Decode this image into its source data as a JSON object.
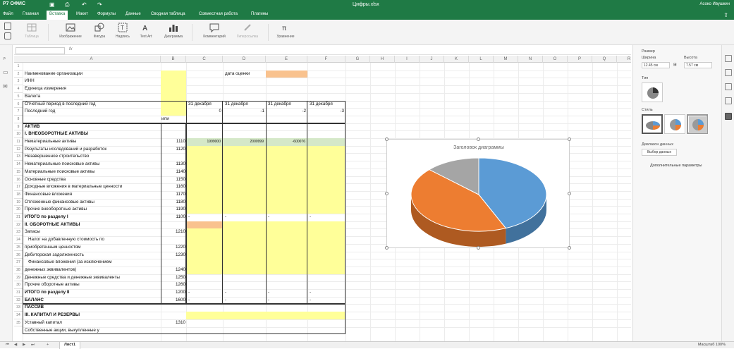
{
  "app": {
    "logo": "Р7 ОФИС",
    "doc_title": "Цифры.xlsx",
    "user": "Асоко Ивушкин"
  },
  "menu": {
    "tabs": [
      "Файл",
      "Главная",
      "Вставка",
      "Макет",
      "Формулы",
      "Данные",
      "Сводная таблица",
      "Совместная работа",
      "Плагины"
    ],
    "active": "Вставка"
  },
  "ribbon": {
    "items": [
      {
        "label": "Таблица",
        "icon": "table-icon",
        "dim": true
      },
      {
        "label": "Изображение",
        "icon": "image-icon"
      },
      {
        "label": "Фигура",
        "icon": "shapes-icon"
      },
      {
        "label": "Надпись",
        "icon": "text-box-icon"
      },
      {
        "label": "Text Art",
        "icon": "text-art-icon"
      },
      {
        "label": "Диаграмма",
        "icon": "chart-icon"
      },
      {
        "label": "Комментарий",
        "icon": "comment-icon"
      },
      {
        "label": "Гиперссылка",
        "icon": "hyperlink-icon",
        "dim": true
      },
      {
        "label": "Уравнение",
        "icon": "equation-icon"
      }
    ]
  },
  "columns": [
    "A",
    "B",
    "C",
    "D",
    "E",
    "F",
    "G",
    "H",
    "I",
    "J",
    "K",
    "L",
    "M",
    "N",
    "O",
    "P",
    "Q",
    "R"
  ],
  "rows": [
    "1",
    "2",
    "3",
    "4",
    "5",
    "6",
    "7",
    "8",
    "9",
    "10",
    "11",
    "12",
    "13",
    "14",
    "15",
    "16",
    "17",
    "18",
    "19",
    "20",
    "21",
    "22",
    "23",
    "24",
    "25",
    "26",
    "27",
    "28",
    "29",
    "30",
    "31",
    "32",
    "33",
    "34",
    "35"
  ],
  "sheet": {
    "org_label": "Наименование организации",
    "inn": "ИНН",
    "unit": "Единица измерения",
    "currency": "Валюта",
    "period_last": "Отчетный период в последний год",
    "last_year": "Последний год",
    "date_label": "дата оценки",
    "or_label": "или",
    "dec31": "31 декабря",
    "offsets": [
      "0",
      "-1",
      "-2",
      "-3"
    ],
    "assets": "АКТИВ",
    "section1": "I. ВНЕОБОРОТНЫЕ АКТИВЫ",
    "lines": [
      {
        "label": "Нематериальные активы",
        "code": "1110"
      },
      {
        "label": "Результаты исследований и разработок",
        "code": "1120"
      },
      {
        "label": "Незавершенное строительство",
        "code": ""
      },
      {
        "label": "Нематериальные поисковые активы",
        "code": "1130"
      },
      {
        "label": "Материальные поисковые активы",
        "code": "1140"
      },
      {
        "label": "Основные средства",
        "code": "1150"
      },
      {
        "label": "Доходные вложения в материальные ценности",
        "code": "1160"
      },
      {
        "label": "Финансовые вложения",
        "code": "1170"
      },
      {
        "label": "Отложенные финансовые активы",
        "code": "1180"
      },
      {
        "label": "Прочие внеоборотные активы",
        "code": "1190"
      }
    ],
    "values_1110": [
      "1999000",
      "2000999",
      "-600076"
    ],
    "total1": "ИТОГО по разделу I",
    "total1_code": "1100",
    "dash": "-",
    "section2": "II. ОБОРОТНЫЕ АКТИВЫ",
    "stock": "Запасы",
    "stock_code": "1210",
    "vat_1": "Налог на добавленную стоимость по",
    "vat_2": "приобретенным ценностям",
    "vat_code": "1220",
    "receivables": "Дебиторская задолженность",
    "receivables_code": "1230",
    "fin_inv_1": "Финансовые вложения (за исключением",
    "fin_inv_2": "денежных эквивалентов)",
    "fin_inv_code": "1240",
    "cash": "Денежные средства и денежные эквиваленты",
    "cash_code": "1250",
    "other_current": "Прочие оборотные активы",
    "other_current_code": "1260",
    "total2": "ИТОГО по разделу II",
    "total2_code": "1200",
    "balance": "БАЛАНС",
    "balance_code": "1600",
    "liabilities": "ПАССИВ",
    "section3": "III. КАПИТАЛ И РЕЗЕРВЫ",
    "charter": "Уставный капитал",
    "charter_code": "1310",
    "own_shares": "Собственные акции, выкупленные у"
  },
  "chart": {
    "title": "Заголовок диаграммы",
    "colors": [
      "#5b9bd5",
      "#ed7d31",
      "#a5a5a5"
    ]
  },
  "chart_data": {
    "type": "pie",
    "title": "Заголовок диаграммы",
    "values": [
      1999000,
      2000999,
      600076
    ],
    "colors": [
      "#5b9bd5",
      "#ed7d31",
      "#a5a5a5"
    ]
  },
  "panel": {
    "size_label": "Размер",
    "width_label": "Ширина",
    "height_label": "Высота",
    "width_val": "12.45 см",
    "height_val": "7.57 см",
    "type_label": "Тип",
    "style_label": "Стиль",
    "data_range_label": "Диапазон данных",
    "select_data": "Выбор данных",
    "advanced": "Дополнительные параметры"
  },
  "status": {
    "sheet_tab": "Лист1",
    "zoom": "Масштаб 100%"
  }
}
